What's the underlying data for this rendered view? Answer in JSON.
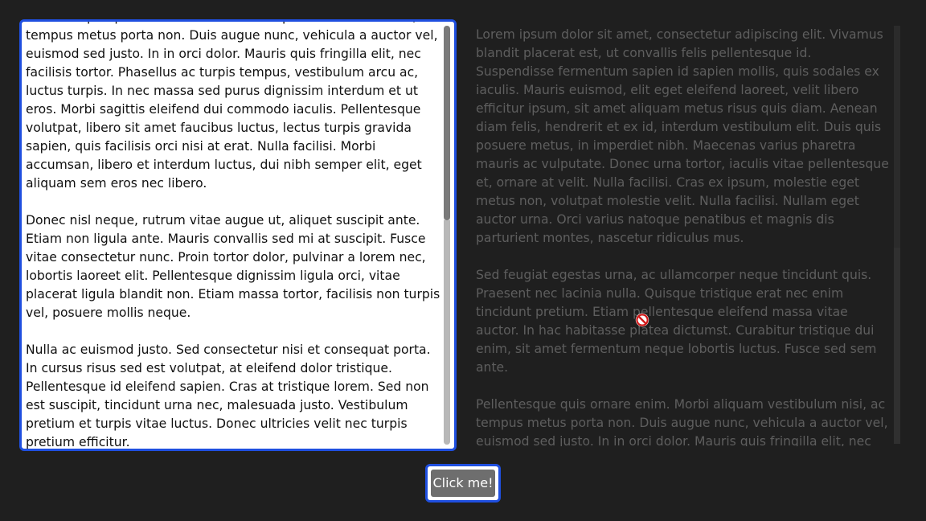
{
  "left_panel": {
    "paragraphs": [
      "Pellentesque quis ornare enim. Morbi aliquam vestibulum nisi, ac tempus metus porta non. Duis augue nunc, vehicula a auctor vel, euismod sed justo. In in orci dolor. Mauris quis fringilla elit, nec facilisis tortor. Phasellus ac turpis tempus, vestibulum arcu ac, luctus turpis. In nec massa sed purus dignissim interdum et ut eros. Morbi sagittis eleifend dui commodo iaculis. Pellentesque volutpat, libero sit amet faucibus luctus, lectus turpis gravida sapien, quis facilisis orci nisi at erat. Nulla facilisi. Morbi accumsan, libero et interdum luctus, dui nibh semper elit, eget aliquam sem eros nec libero.",
      "Donec nisl neque, rutrum vitae augue ut, aliquet suscipit ante. Etiam non ligula ante. Mauris convallis sed mi at suscipit. Fusce vitae consectetur nunc. Proin tortor dolor, pulvinar a lorem nec, lobortis laoreet elit. Pellentesque dignissim ligula orci, vitae placerat ligula blandit non. Etiam massa tortor, facilisis non turpis vel, posuere mollis neque.",
      "Nulla ac euismod justo. Sed consectetur nisi et consequat porta. In cursus risus sed est volutpat, at eleifend dolor tristique. Pellentesque id eleifend sapien. Cras at tristique lorem. Sed non est suscipit, tincidunt urna nec, malesuada justo. Vestibulum pretium et turpis vitae luctus. Donec ultricies velit nec turpis pretium efficitur."
    ]
  },
  "right_panel": {
    "paragraphs": [
      "Lorem ipsum dolor sit amet, consectetur adipiscing elit. Vivamus blandit placerat est, ut convallis felis pellentesque id. Suspendisse fermentum sapien id sapien mollis, quis sodales ex iaculis. Mauris euismod, elit eget eleifend laoreet, velit libero efficitur ipsum, sit amet aliquam metus risus quis diam. Aenean diam felis, hendrerit et ex id, interdum vestibulum elit. Duis quis posuere metus, in imperdiet nibh. Maecenas varius pharetra mauris ac vulputate. Donec urna tortor, iaculis vitae pellentesque et, ornare at velit. Nulla facilisi. Cras ex ipsum, molestie eget metus non, volutpat molestie velit. Nulla facilisi. Nullam eget auctor urna. Orci varius natoque penatibus et magnis dis parturient montes, nascetur ridiculus mus.",
      "Sed feugiat egestas urna, ac ullamcorper neque tincidunt quis. Praesent nec lacinia nulla. Quisque tristique erat nec enim tincidunt pretium. Etiam pellentesque eleifend massa vitae auctor. In hac habitasse platea dictumst. Curabitur tristique dui enim, sit amet fermentum neque lobortis luctus. Fusce sed sem ante.",
      "Pellentesque quis ornare enim. Morbi aliquam vestibulum nisi, ac tempus metus porta non. Duis augue nunc, vehicula a auctor vel, euismod sed justo. In in orci dolor. Mauris quis fringilla elit, nec facilisis tortor. Phasellus ac turpis tempus, vestibulum arcu ac,"
    ]
  },
  "button": {
    "label": "Click me!"
  },
  "cursor": {
    "icon": "not-allowed-icon"
  },
  "colors": {
    "focus_border": "#1f4fe0",
    "background": "#1f1f1f",
    "button_fill": "#6e6e6e"
  }
}
